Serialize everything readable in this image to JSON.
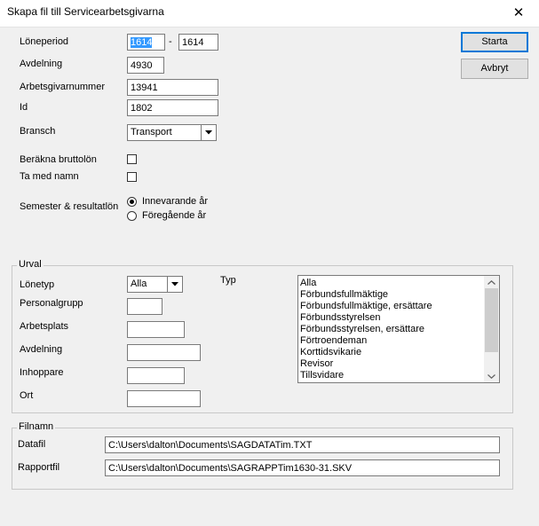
{
  "window": {
    "title": "Skapa fil till Servicearbetsgivarna",
    "close_glyph": "✕"
  },
  "form": {
    "loneperiod_label": "Löneperiod",
    "loneperiod_from": "1614",
    "loneperiod_sep": "-",
    "loneperiod_to": "1614",
    "avdelning_label": "Avdelning",
    "avdelning_value": "4930",
    "arbetsgivarnummer_label": "Arbetsgivarnummer",
    "arbetsgivarnummer_value": "13941",
    "id_label": "Id",
    "id_value": "1802",
    "bransch_label": "Bransch",
    "bransch_value": "Transport",
    "berakna_label": "Beräkna bruttolön",
    "berakna_checked": false,
    "tamed_label": "Ta med namn",
    "tamed_checked": false,
    "semester_label": "Semester & resultatlön",
    "radio_current": "Innevarande år",
    "radio_previous": "Föregående år",
    "radio_selected": "current"
  },
  "buttons": {
    "start": "Starta",
    "cancel": "Avbryt"
  },
  "urval": {
    "legend": "Urval",
    "lonetyp_label": "Lönetyp",
    "lonetyp_value": "Alla",
    "personalgrupp_label": "Personalgrupp",
    "personalgrupp_value": "",
    "arbetsplats_label": "Arbetsplats",
    "arbetsplats_value": "",
    "avdelning_label": "Avdelning",
    "avdelning_value": "",
    "inhoppare_label": "Inhoppare",
    "inhoppare_value": "",
    "ort_label": "Ort",
    "ort_value": "",
    "typ_label": "Typ",
    "typ_items": [
      "Alla",
      "Förbundsfullmäktige",
      "Förbundsfullmäktige, ersättare",
      "Förbundsstyrelsen",
      "Förbundsstyrelsen, ersättare",
      "Förtroendeman",
      "Korttidsvikarie",
      "Revisor",
      "Tillsvidare"
    ]
  },
  "filnamn": {
    "legend": "Filnamn",
    "datafil_label": "Datafil",
    "datafil_value": "C:\\Users\\dalton\\Documents\\SAGDATATim.TXT",
    "rapportfil_label": "Rapportfil",
    "rapportfil_value": "C:\\Users\\dalton\\Documents\\SAGRAPPTim1630-31.SKV"
  }
}
